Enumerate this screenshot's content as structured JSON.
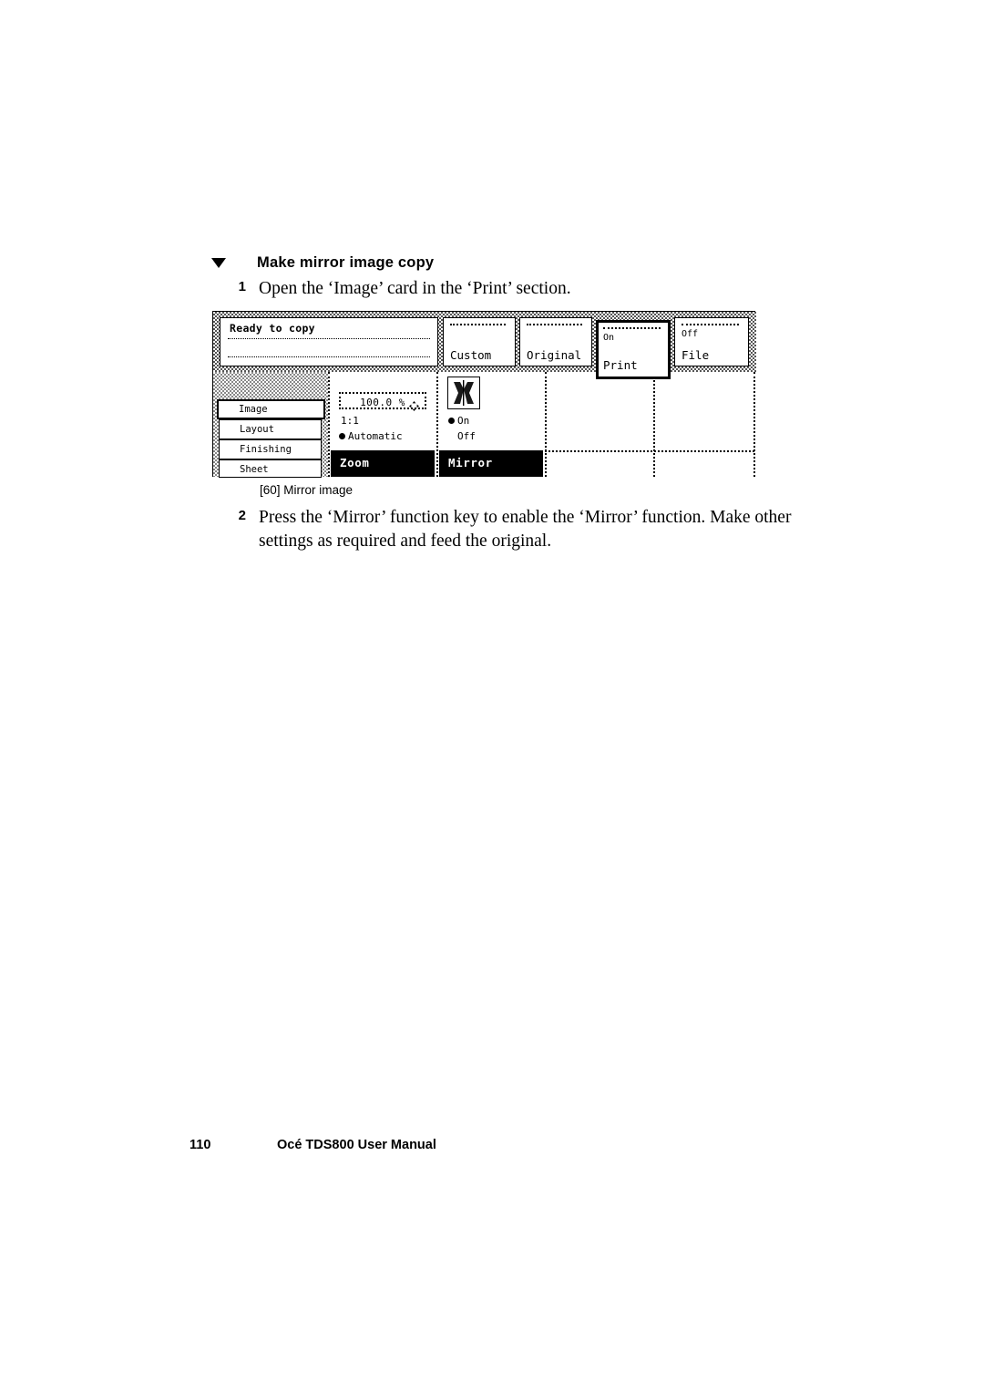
{
  "section": {
    "heading": "Make mirror image copy",
    "steps": [
      {
        "number": "1",
        "text": "Open the ‘Image’ card in the ‘Print’ section."
      },
      {
        "number": "2",
        "text": "Press the ‘Mirror’ function key to enable the ‘Mirror’ function. Make other settings as required and feed the original."
      }
    ]
  },
  "figure": {
    "caption": "[60] Mirror image",
    "screen": {
      "status": {
        "message": "Ready to copy"
      },
      "tabs": [
        {
          "sub": "",
          "label": "Custom",
          "selected": false
        },
        {
          "sub": "",
          "label": "Original",
          "selected": false
        },
        {
          "sub": "On",
          "label": "Print",
          "selected": true
        },
        {
          "sub": "Off",
          "label": "File",
          "selected": false
        }
      ],
      "sidebar": [
        {
          "label": "Image",
          "selected": true
        },
        {
          "label": "Layout",
          "selected": false
        },
        {
          "label": "Finishing",
          "selected": false
        },
        {
          "label": "Sheet",
          "selected": false
        }
      ],
      "zoom_column": {
        "function_key": "Zoom",
        "value": "100.0 %",
        "spinner_icon": "four-way-arrow-icon",
        "options": [
          {
            "label": "1:1",
            "selected": false
          },
          {
            "label": "Automatic",
            "selected": true
          }
        ]
      },
      "mirror_column": {
        "function_key": "Mirror",
        "preview_icon": "mirrored-letter-icon",
        "options": [
          {
            "label": "On",
            "selected": true
          },
          {
            "label": "Off",
            "selected": false
          }
        ]
      }
    }
  },
  "footer": {
    "page_number": "110",
    "title": "Océ TDS800 User Manual"
  }
}
